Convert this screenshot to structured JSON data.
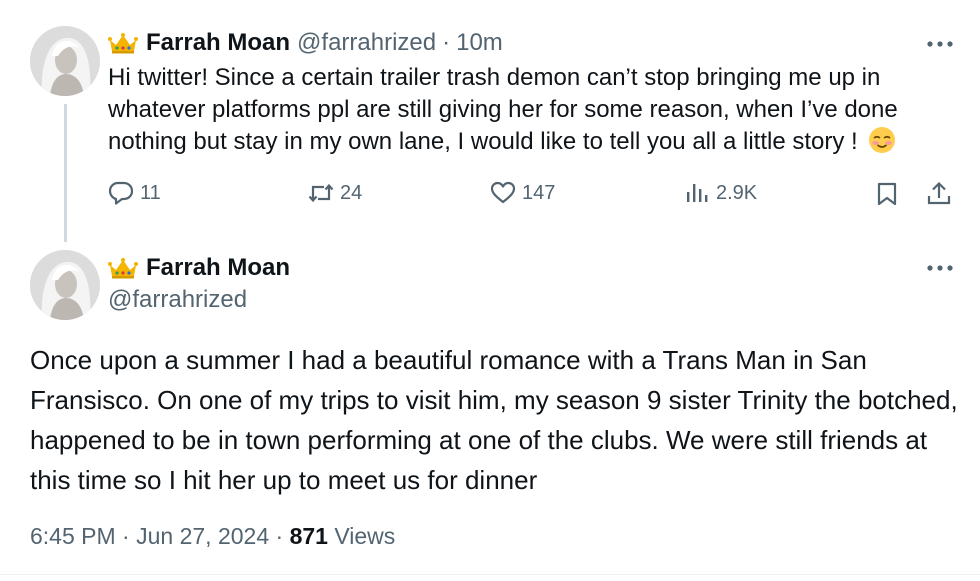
{
  "tweet1": {
    "display_name": "Farrah Moan",
    "handle": "@farrahrized",
    "separator": "·",
    "time": "10m",
    "text": "Hi twitter! Since a certain trailer trash demon can’t stop bringing me up in whatever platforms ppl are still giving her for some reason, when I’ve done nothing but stay in my own lane, I would like to tell you all a little story !",
    "emoji_icon": "smiling-blushing-face-icon",
    "actions": {
      "replies": "11",
      "retweets": "24",
      "likes": "147",
      "views": "2.9K"
    }
  },
  "tweet2": {
    "display_name": "Farrah Moan",
    "handle": "@farrahrized",
    "text": "Once upon a summer I had a beautiful romance with a Trans Man in San Fransisco. On one of my trips to visit him, my season 9 sister Trinity the botched, happened to be in town performing at one of the clubs. We were still friends at this time so I hit her up to meet us for dinner",
    "time": "6:45 PM",
    "separator": "·",
    "date": "Jun 27, 2024",
    "views_count": "871",
    "views_label": "Views"
  },
  "colors": {
    "text": "#0f1419",
    "secondary": "#536471",
    "thread_line": "#cfd9de",
    "crown": "#f4b400"
  }
}
